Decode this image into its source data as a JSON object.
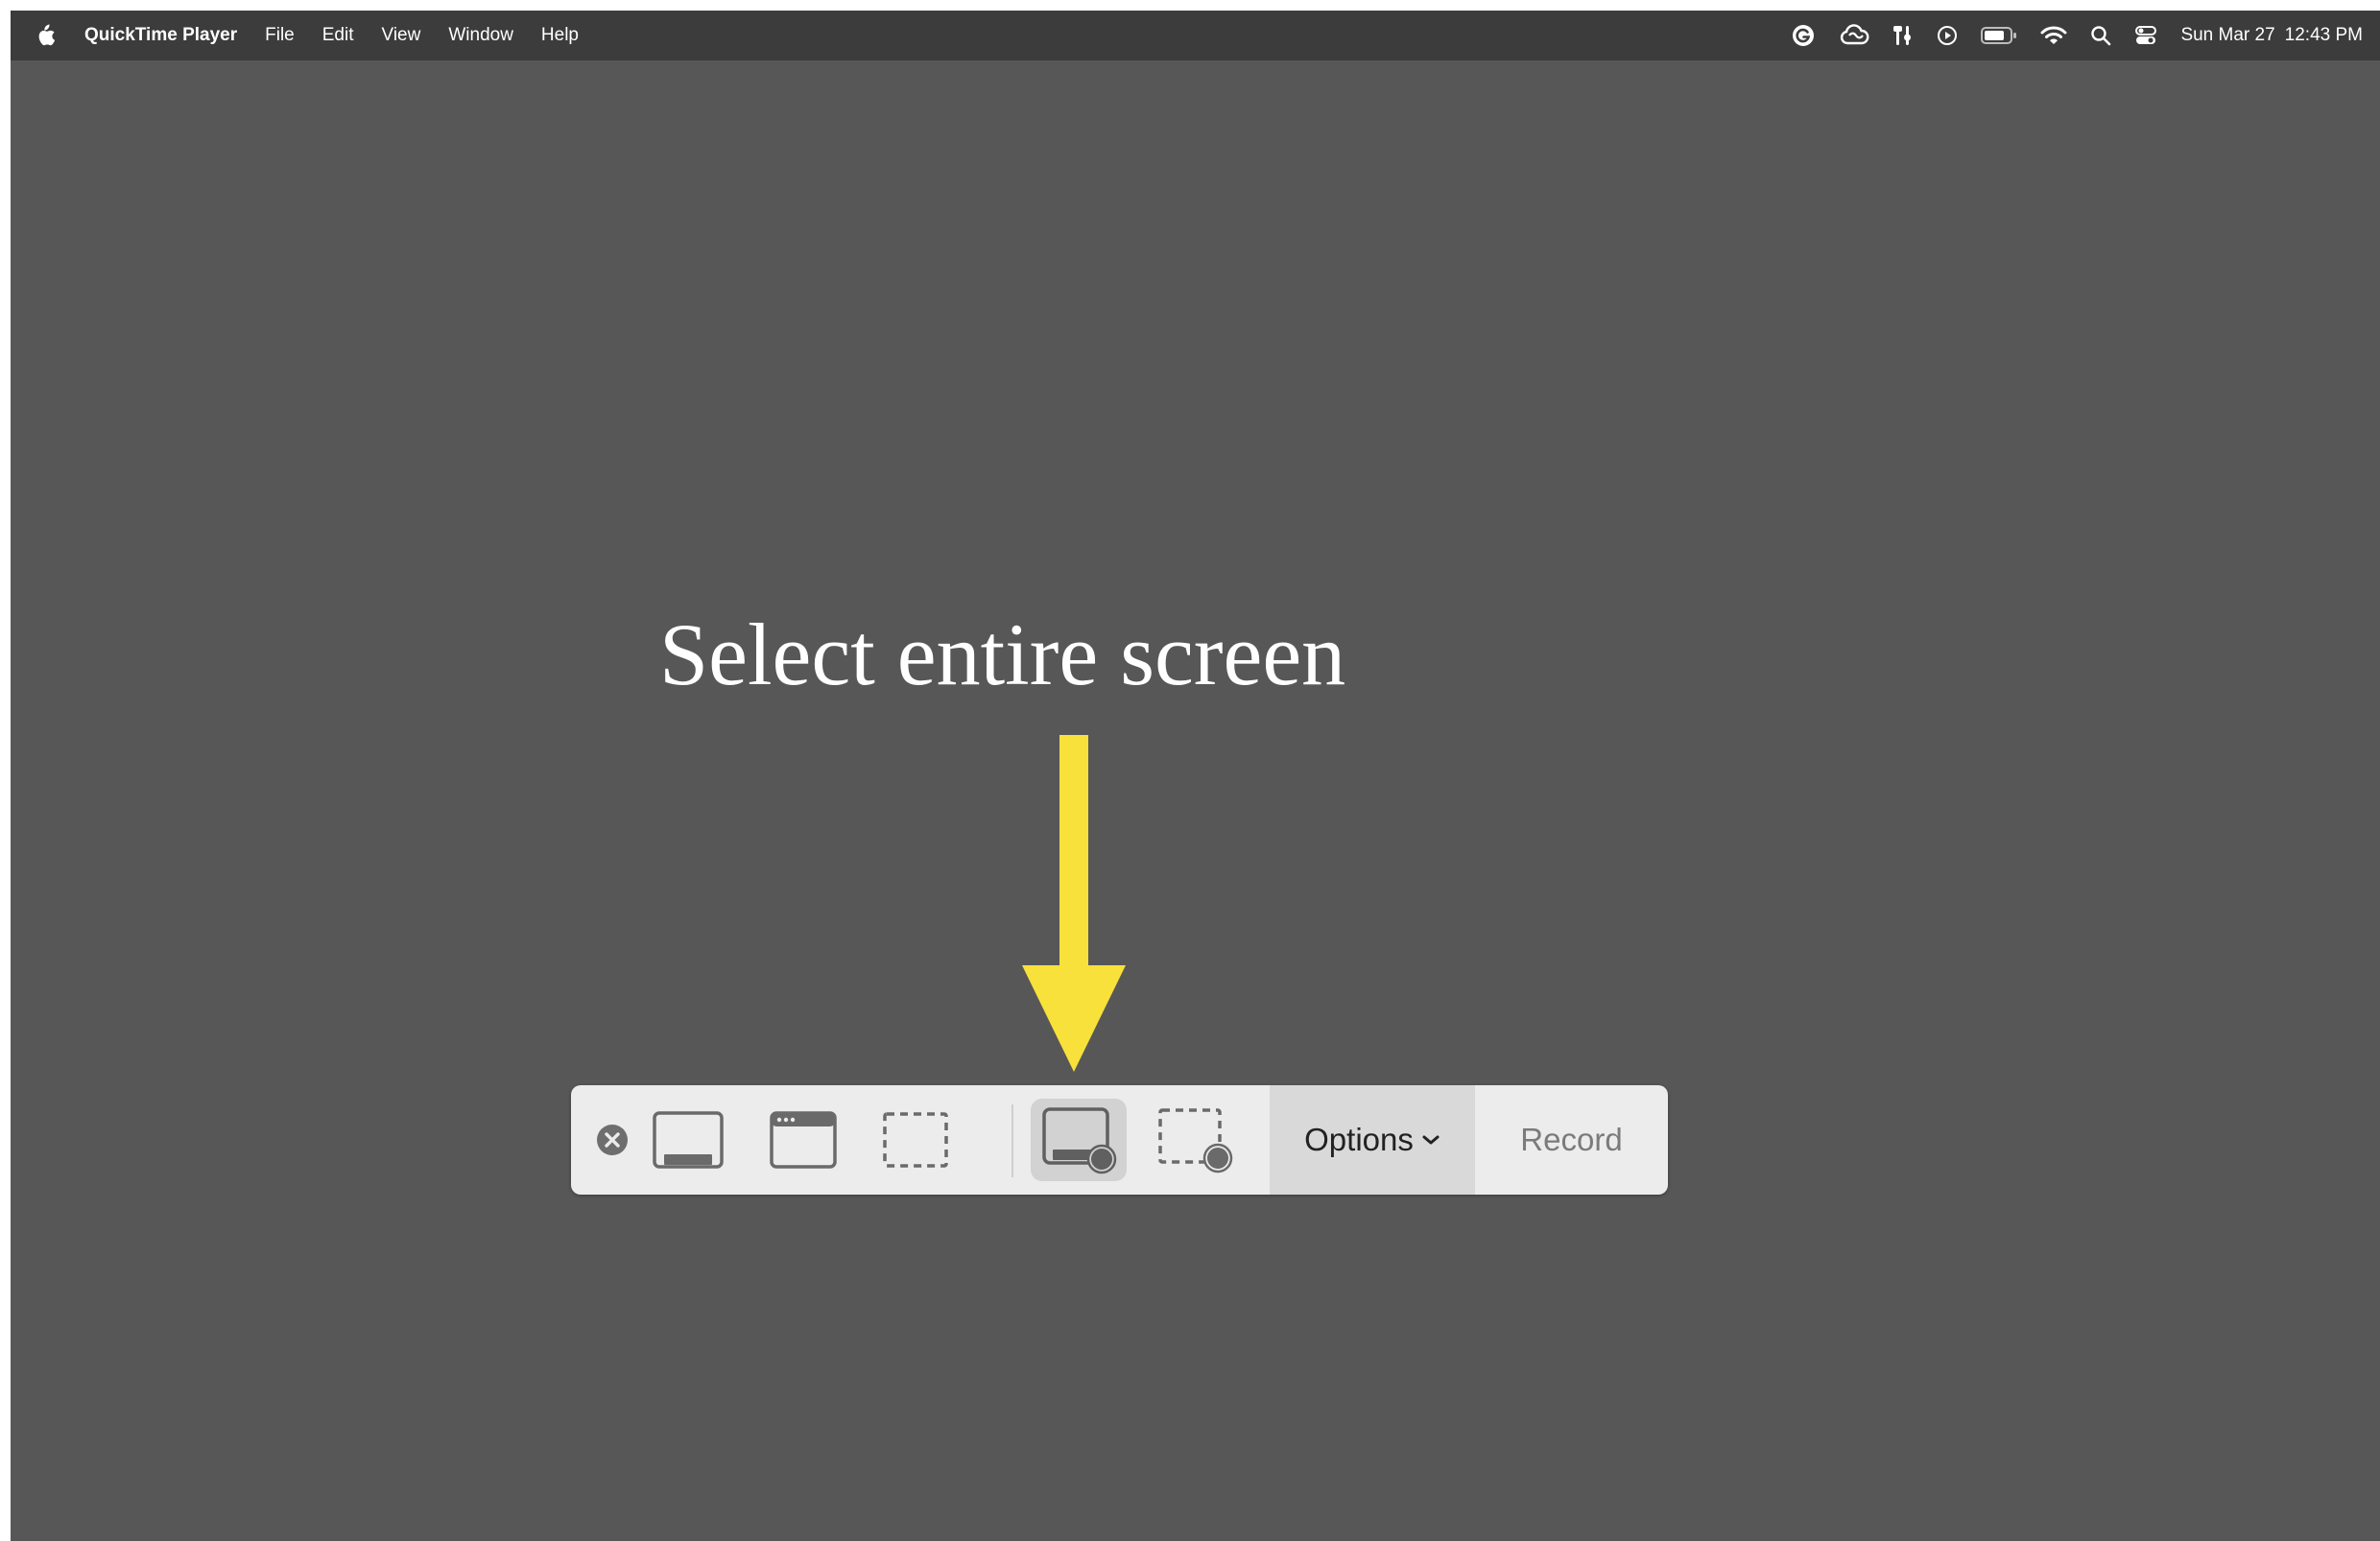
{
  "menubar": {
    "app_name": "QuickTime Player",
    "menus": [
      "File",
      "Edit",
      "View",
      "Window",
      "Help"
    ],
    "status_icons": [
      "grammarly-icon",
      "creative-cloud-icon",
      "tools-icon",
      "play-circle-icon",
      "battery-icon",
      "wifi-icon",
      "spotlight-search-icon",
      "control-center-icon"
    ],
    "date": "Sun Mar 27",
    "time": "12:43 PM"
  },
  "annotation": {
    "text": "Select entire screen",
    "arrow_color": "#f7e13a"
  },
  "toolbar": {
    "buttons": [
      "close-icon",
      "capture-entire-screen-icon",
      "capture-window-icon",
      "capture-selection-icon",
      "record-entire-screen-icon",
      "record-selection-icon"
    ],
    "selected": "record-entire-screen-icon",
    "options_label": "Options",
    "record_label": "Record"
  },
  "colors": {
    "desktop": "#575757",
    "menubar": "#3c3c3c",
    "toolbar": "#ececec",
    "options_bg": "#d9d9d9"
  }
}
